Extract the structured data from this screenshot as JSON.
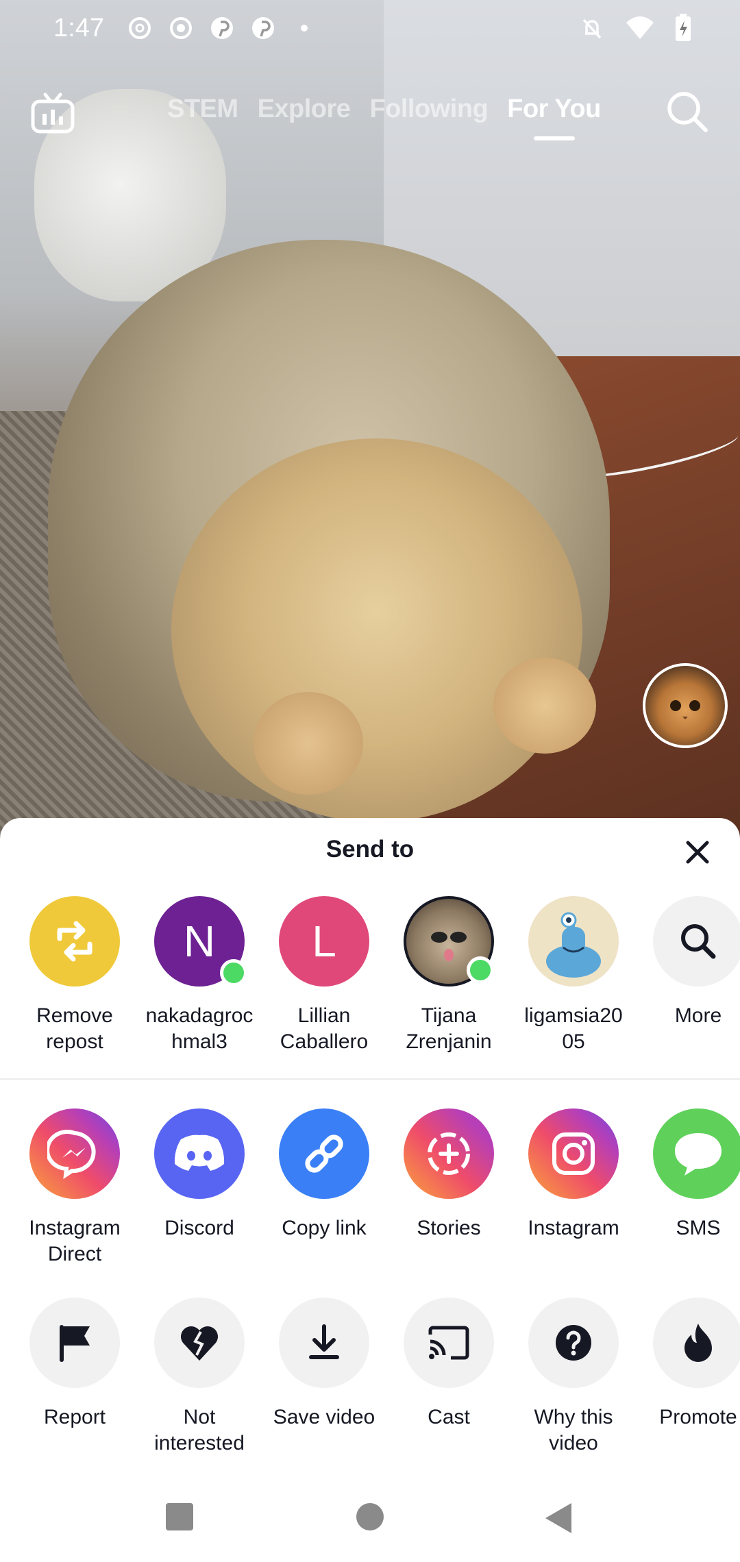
{
  "status_bar": {
    "time": "1:47"
  },
  "top_nav": {
    "tabs": [
      {
        "label": "STEM",
        "active": false
      },
      {
        "label": "Explore",
        "active": false
      },
      {
        "label": "Following",
        "active": false
      },
      {
        "label": "For You",
        "active": true
      }
    ]
  },
  "sheet": {
    "title": "Send to",
    "contacts": [
      {
        "label": "Remove\nrepost",
        "icon": "repost-icon",
        "color": "#f0c93a"
      },
      {
        "label": "nakadagroc\nhmal3",
        "letter": "N",
        "color": "#6d2193",
        "online": true
      },
      {
        "label": "Lillian\nCaballero",
        "letter": "L",
        "color": "#e0487a",
        "online": false
      },
      {
        "label": "Tijana\nZrenjanin",
        "icon": "avatar-cat-photo",
        "online": true
      },
      {
        "label": "ligamsia20\n05",
        "icon": "avatar-blue-monster",
        "color": "#efe3c6"
      },
      {
        "label": "More",
        "icon": "search-icon",
        "color": "#f1f1f2"
      }
    ],
    "apps": [
      {
        "label": "Instagram\nDirect",
        "icon": "messenger-icon"
      },
      {
        "label": "Discord",
        "icon": "discord-icon",
        "color": "#5865f2"
      },
      {
        "label": "Copy link",
        "icon": "link-icon",
        "color": "#3a7ff6"
      },
      {
        "label": "Stories",
        "icon": "stories-icon"
      },
      {
        "label": "Instagram",
        "icon": "instagram-icon"
      },
      {
        "label": "SMS",
        "icon": "sms-icon",
        "color": "#5fd15a"
      }
    ],
    "actions": [
      {
        "label": "Report",
        "icon": "flag-icon"
      },
      {
        "label": "Not\ninterested",
        "icon": "broken-heart-icon"
      },
      {
        "label": "Save video",
        "icon": "download-icon"
      },
      {
        "label": "Cast",
        "icon": "cast-icon"
      },
      {
        "label": "Why this\nvideo",
        "icon": "question-icon"
      },
      {
        "label": "Promote",
        "icon": "flame-icon"
      }
    ]
  }
}
